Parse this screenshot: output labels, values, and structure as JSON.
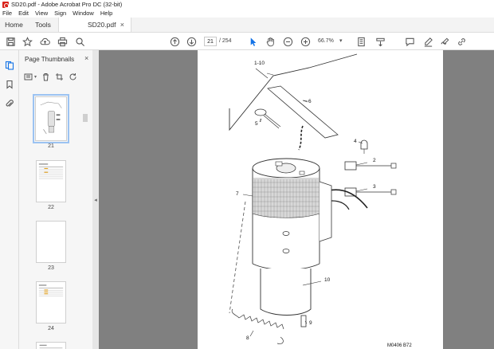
{
  "window": {
    "title": "SD20.pdf - Adobe Acrobat Pro DC (32-bit)"
  },
  "menu": [
    "File",
    "Edit",
    "View",
    "Sign",
    "Window",
    "Help"
  ],
  "tabs": {
    "home": "Home",
    "tools": "Tools",
    "document": "SD20.pdf"
  },
  "toolbar": {
    "current_page": "21",
    "total_pages": "/ 254",
    "zoom": "66.7%"
  },
  "panel": {
    "title": "Page Thumbnails",
    "thumbnails": [
      {
        "label": "21",
        "selected": true
      },
      {
        "label": "22",
        "selected": false
      },
      {
        "label": "23",
        "selected": false
      },
      {
        "label": "24",
        "selected": false
      }
    ]
  },
  "drawing": {
    "callouts": [
      "1-10",
      "6",
      "5",
      "4",
      "2",
      "7",
      "3",
      "10",
      "9",
      "8"
    ],
    "footer_code": "M0406 B72"
  }
}
